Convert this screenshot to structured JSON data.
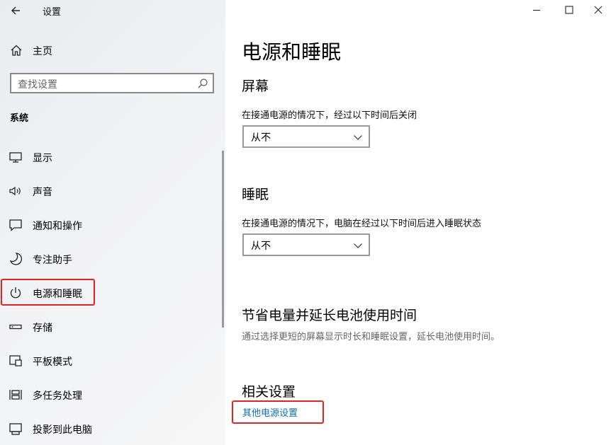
{
  "window": {
    "title": "设置"
  },
  "sidebar": {
    "home_label": "主页",
    "search_placeholder": "查找设置",
    "section_label": "系统",
    "items": [
      {
        "label": "显示",
        "icon": "monitor-icon"
      },
      {
        "label": "声音",
        "icon": "speaker-icon"
      },
      {
        "label": "通知和操作",
        "icon": "notification-icon"
      },
      {
        "label": "专注助手",
        "icon": "moon-icon"
      },
      {
        "label": "电源和睡眠",
        "icon": "power-icon",
        "selected": true
      },
      {
        "label": "存储",
        "icon": "storage-icon"
      },
      {
        "label": "平板模式",
        "icon": "tablet-icon"
      },
      {
        "label": "多任务处理",
        "icon": "multitask-icon"
      },
      {
        "label": "投影到此电脑",
        "icon": "project-icon"
      }
    ]
  },
  "main": {
    "title": "电源和睡眠",
    "screen": {
      "heading": "屏幕",
      "description": "在接通电源的情况下，经过以下时间后关闭",
      "value": "从不"
    },
    "sleep": {
      "heading": "睡眠",
      "description": "在接通电源的情况下，电脑在经过以下时间后进入睡眠状态",
      "value": "从不"
    },
    "battery": {
      "heading": "节省电量并延长电池使用时间",
      "description": "通过选择更短的屏幕显示时长和睡眠设置，延长电池使用时间。"
    },
    "related": {
      "heading": "相关设置",
      "link": "其他电源设置"
    }
  },
  "colors": {
    "highlight": "#e02424",
    "link": "#0b6fb8"
  }
}
